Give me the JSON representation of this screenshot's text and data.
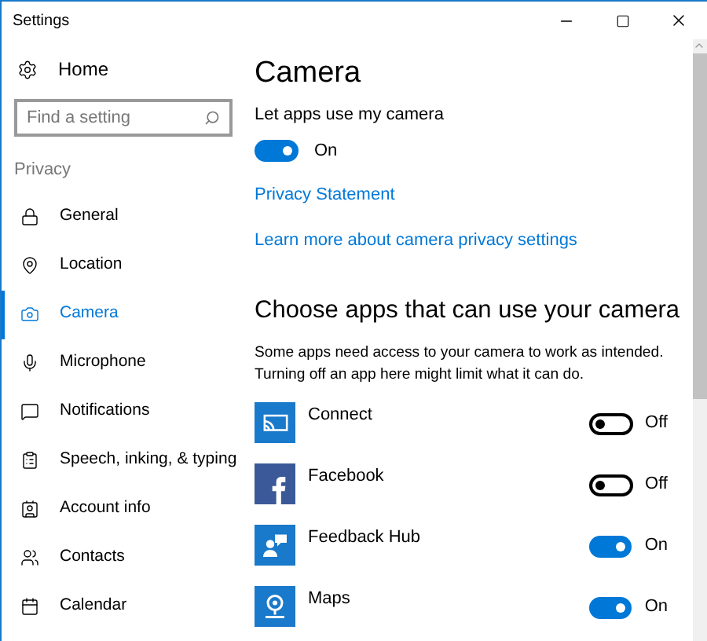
{
  "window": {
    "title": "Settings"
  },
  "sidebar": {
    "home": "Home",
    "search": {
      "placeholder": "Find a setting"
    },
    "section": "Privacy",
    "items": [
      {
        "label": "General",
        "selected": false
      },
      {
        "label": "Location",
        "selected": false
      },
      {
        "label": "Camera",
        "selected": true
      },
      {
        "label": "Microphone",
        "selected": false
      },
      {
        "label": "Notifications",
        "selected": false
      },
      {
        "label": "Speech, inking, & typing",
        "selected": false
      },
      {
        "label": "Account info",
        "selected": false
      },
      {
        "label": "Contacts",
        "selected": false
      },
      {
        "label": "Calendar",
        "selected": false
      }
    ]
  },
  "main": {
    "title": "Camera",
    "setting_label": "Let apps use my camera",
    "master_toggle": {
      "on": true,
      "label": "On"
    },
    "links": [
      "Privacy Statement",
      "Learn more about camera privacy settings"
    ],
    "apps_heading": "Choose apps that can use your camera",
    "description": [
      "Some apps need access to your camera to work as intended.",
      "Turning off an app here might limit what it can do."
    ],
    "apps": [
      {
        "name": "Connect",
        "kind": "cast",
        "color": "#1979ca",
        "on": false,
        "label": "Off"
      },
      {
        "name": "Facebook",
        "kind": "facebook",
        "color": "#3b5998",
        "on": false,
        "label": "Off"
      },
      {
        "name": "Feedback Hub",
        "kind": "feedback",
        "color": "#1979ca",
        "on": true,
        "label": "On"
      },
      {
        "name": "Maps",
        "kind": "maps",
        "color": "#1979ca",
        "on": true,
        "label": "On"
      }
    ]
  }
}
